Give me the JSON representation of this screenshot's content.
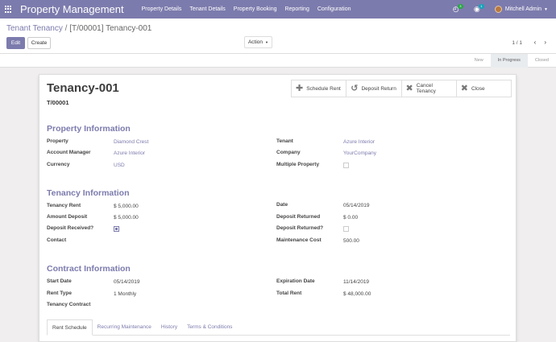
{
  "navbar": {
    "brand": "Property Management",
    "menu": [
      "Property Details",
      "Tenant Details",
      "Property Booking",
      "Reporting",
      "Configuration"
    ],
    "activity_count": "3",
    "message_count": "1",
    "user_name": "Mitchell Admin"
  },
  "control": {
    "breadcrumb_parent": "Tenant Tenancy",
    "breadcrumb_sep": "/",
    "breadcrumb_current": "[T/00001] Tenancy-001",
    "edit_label": "Edit",
    "create_label": "Create",
    "action_label": "Action",
    "pager": "1 / 1"
  },
  "stages": [
    "New",
    "In Progress",
    "Closed"
  ],
  "record": {
    "title": "Tenancy-001",
    "code": "T/00001"
  },
  "buttons": [
    {
      "label": "Schedule Rent",
      "icon": "plus-icon"
    },
    {
      "label": "Deposit Return",
      "icon": "undo-icon"
    },
    {
      "label": "Cancel Tenancy",
      "icon": "cancel-icon"
    },
    {
      "label": "Close",
      "icon": "close-icon"
    }
  ],
  "property_info": {
    "heading": "Property Information",
    "property_label": "Property",
    "property_value": "Diamond Crest",
    "account_manager_label": "Account Manager",
    "account_manager_value": "Azure Interior",
    "currency_label": "Currency",
    "currency_value": "USD",
    "tenant_label": "Tenant",
    "tenant_value": "Azure Interior",
    "company_label": "Company",
    "company_value": "YourCompany",
    "multiple_label": "Multiple Property",
    "multiple_value": false
  },
  "tenancy_info": {
    "heading": "Tenancy Information",
    "rent_label": "Tenancy Rent",
    "rent_value": "$ 5,000.00",
    "deposit_label": "Amount Deposit",
    "deposit_value": "$ 5,000.00",
    "deposit_received_label": "Deposit Received?",
    "deposit_received_value": true,
    "contact_label": "Contact",
    "date_label": "Date",
    "date_value": "05/14/2019",
    "returned_label": "Deposit Returned",
    "returned_value": "$ 0.00",
    "returned_q_label": "Deposit Returned?",
    "returned_q_value": false,
    "maintenance_label": "Maintenance Cost",
    "maintenance_value": "500.00"
  },
  "contract_info": {
    "heading": "Contract Information",
    "start_label": "Start Date",
    "start_value": "05/14/2019",
    "rent_type_label": "Rent Type",
    "rent_type_value": "1 Monthly",
    "contract_label": "Tenancy Contract",
    "expiration_label": "Expiration Date",
    "expiration_value": "11/14/2019",
    "total_label": "Total Rent",
    "total_value": "$ 48,000.00"
  },
  "tabs": [
    "Rent Schedule",
    "Recurring Maintenance",
    "History",
    "Terms & Conditions"
  ],
  "colors": {
    "accent": "#7c7bad",
    "badge_green": "#28a745",
    "badge_blue": "#17a2b8"
  }
}
